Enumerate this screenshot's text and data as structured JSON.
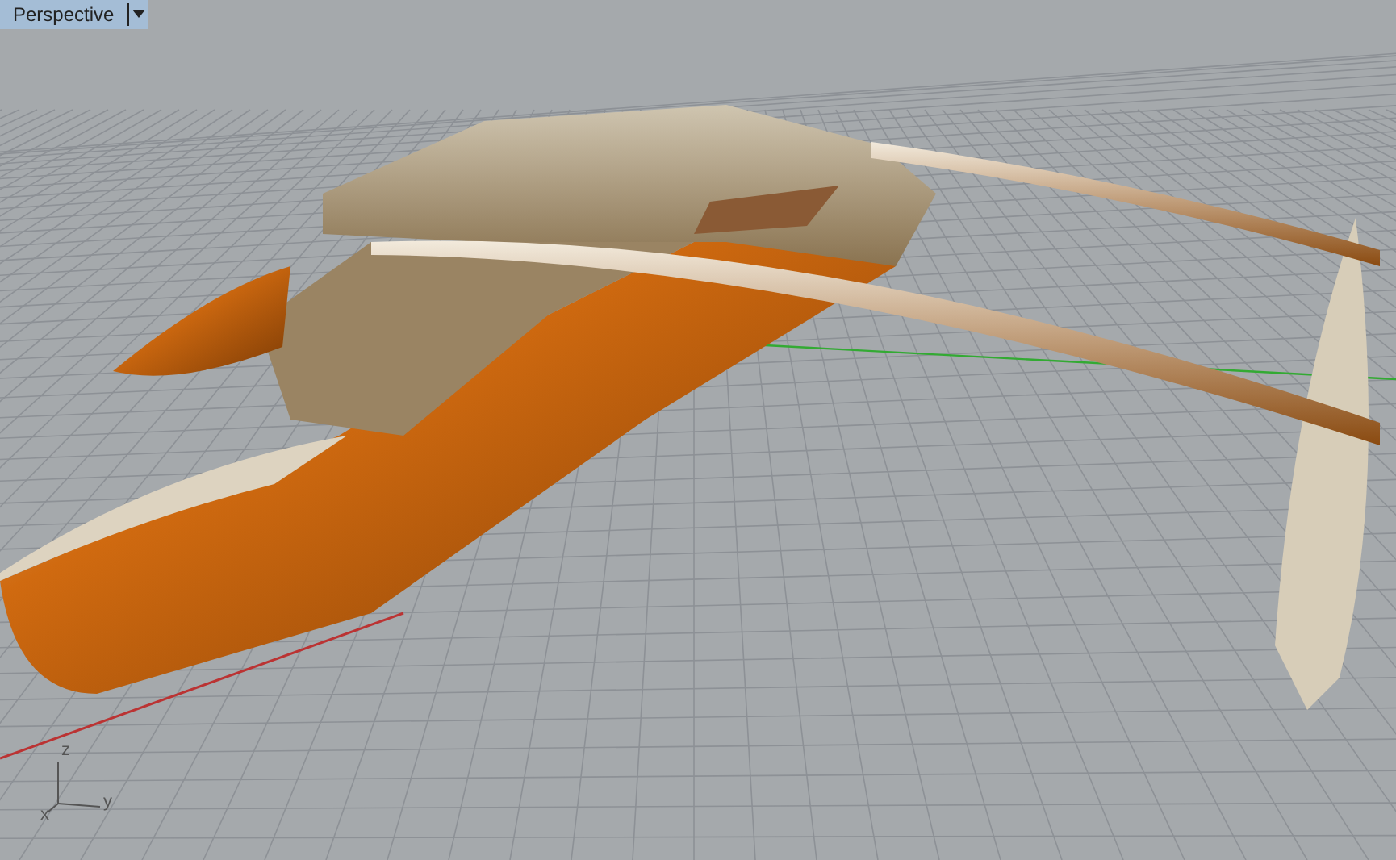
{
  "viewport": {
    "title": "Perspective",
    "axes": {
      "z": "z",
      "y": "y",
      "x": "x"
    }
  }
}
